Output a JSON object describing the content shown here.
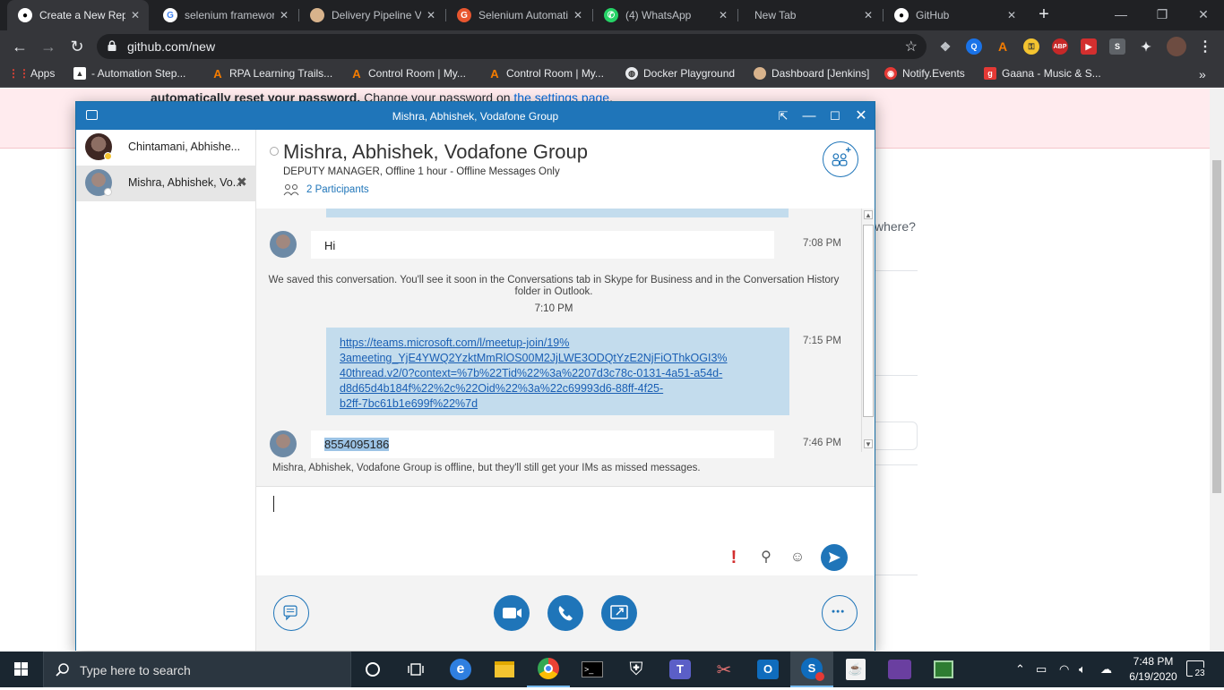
{
  "browser": {
    "tabs": [
      {
        "title": "Create a New Repo",
        "active": true
      },
      {
        "title": "selenium framework"
      },
      {
        "title": "Delivery Pipeline V"
      },
      {
        "title": "Selenium Automation"
      },
      {
        "title": "(4) WhatsApp"
      },
      {
        "title": "New Tab"
      },
      {
        "title": "GitHub"
      }
    ],
    "url": "github.com/new",
    "bookmarks": [
      "Apps",
      "- Automation Step...",
      "RPA Learning Trails...",
      "Control Room | My...",
      "Control Room | My...",
      "Docker Playground",
      "Dashboard [Jenkins]",
      "Notify.Events",
      "Gaana - Music & S..."
    ],
    "extensions": [
      "ABP"
    ],
    "more_bookmarks": "»"
  },
  "page": {
    "flash_bold": "automatically reset your password.",
    "flash_text": " Change your password on ",
    "flash_link": "the settings page",
    "flash_end": ".",
    "fragment": "where?"
  },
  "skype": {
    "window_title": "Mishra, Abhishek, Vodafone Group",
    "conversations": [
      {
        "name": "Chintamani, Abhishe...",
        "presence_color": "#f4c430"
      },
      {
        "name": "Mishra, Abhishek, Vo...",
        "presence_color": "#ffffff",
        "selected": true
      }
    ],
    "contact": {
      "name": "Mishra, Abhishek, Vodafone Group",
      "status": "DEPUTY MANAGER,  Offline 1 hour - Offline Messages Only",
      "participants": "2 Participants"
    },
    "messages": {
      "hi_text": "Hi",
      "hi_time": "7:08 PM",
      "saved_note": "We saved this conversation. You'll see it soon in the Conversations tab in Skype for Business and in the Conversation History folder in Outlook.",
      "saved_time": "7:10 PM",
      "link_lines": [
        "https://teams.microsoft.com/l/meetup-join/19%",
        "3ameeting_YjE4YWQ2YzktMmRlOS00M2JjLWE3ODQtYzE2NjFiOThkOGI3%",
        "40thread.v2/0?context=%7b%22Tid%22%3a%2207d3c78c-0131-4a51-a54d-",
        "d8d65d4b184f%22%2c%22Oid%22%3a%22c69993d6-88ff-4f25-",
        "b2ff-7bc61b1e699f%22%7d"
      ],
      "link_time": "7:15 PM",
      "number_text": "8554095186",
      "number_time": "7:46 PM",
      "offline_note": "Mishra, Abhishek, Vodafone Group is offline, but they'll still get your IMs as missed messages."
    },
    "compose": {
      "priority": "!"
    }
  },
  "taskbar": {
    "search_placeholder": "Type here to search",
    "time": "7:48 PM",
    "date": "6/19/2020",
    "notifications": "23"
  }
}
